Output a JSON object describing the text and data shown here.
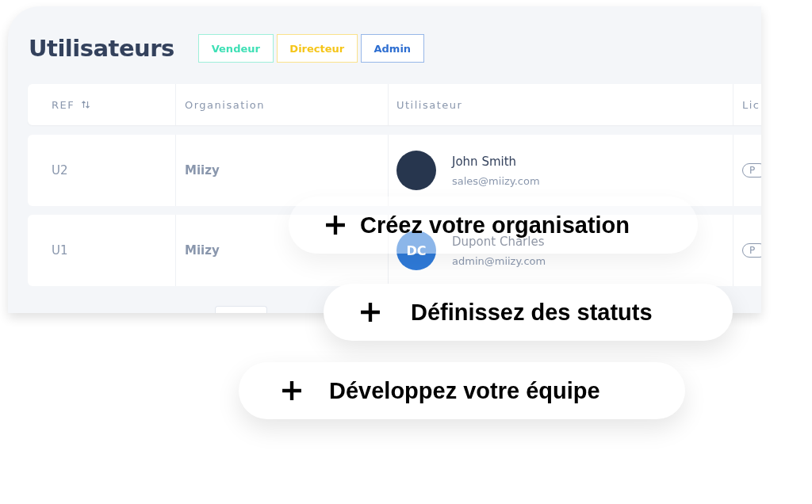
{
  "page": {
    "title": "Utilisateurs",
    "role_tags": [
      {
        "label": "Vendeur",
        "color": "#3ee0b5"
      },
      {
        "label": "Directeur",
        "color": "#f5c518"
      },
      {
        "label": "Admin",
        "color": "#2f6fd1"
      }
    ]
  },
  "table": {
    "columns": [
      {
        "label": "REF",
        "sortable": true
      },
      {
        "label": "Organisation"
      },
      {
        "label": "Utilisateur"
      },
      {
        "label": "Lic"
      }
    ],
    "rows": [
      {
        "ref": "U2",
        "organisation": "Miizy",
        "user": {
          "name": "John Smith",
          "email": "sales@miizy.com",
          "avatar": {
            "kind": "photo"
          }
        },
        "license": "P"
      },
      {
        "ref": "U1",
        "organisation": "Miizy",
        "user": {
          "name": "Dupont Charles",
          "email": "admin@miizy.com",
          "avatar": {
            "kind": "initials",
            "initials": "DC"
          }
        },
        "license": "P"
      }
    ]
  },
  "features": [
    {
      "label": "Créez votre organisation"
    },
    {
      "label": "Définissez des statuts"
    },
    {
      "label": "Développez votre équipe"
    }
  ]
}
